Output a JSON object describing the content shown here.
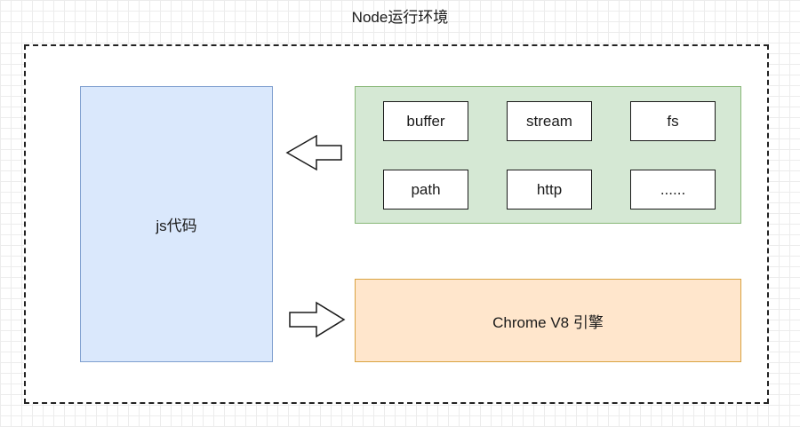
{
  "title": "Node运行环境",
  "js_block": {
    "label": "js代码"
  },
  "modules": [
    {
      "label": "buffer"
    },
    {
      "label": "stream"
    },
    {
      "label": "fs"
    },
    {
      "label": "path"
    },
    {
      "label": "http"
    },
    {
      "label": "......"
    }
  ],
  "engine": {
    "label": "Chrome V8 引擎"
  },
  "colors": {
    "js_fill": "#dae8fc",
    "js_border": "#7f9fcf",
    "modules_fill": "#d5e8d4",
    "modules_border": "#89b878",
    "engine_fill": "#ffe6cc",
    "engine_border": "#d9a341"
  }
}
